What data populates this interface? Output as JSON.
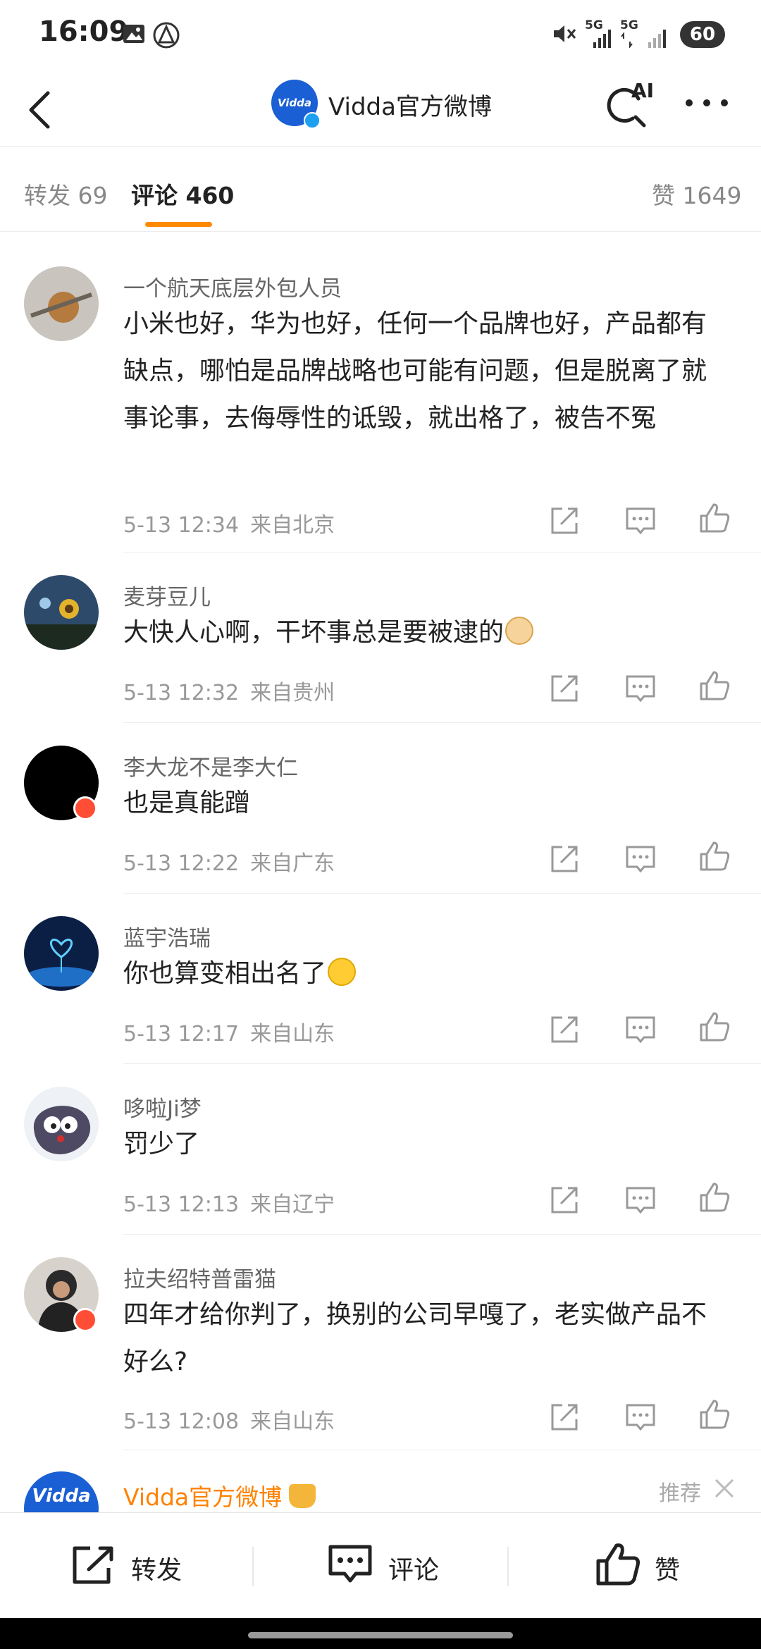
{
  "status_bar": {
    "time": "16:09",
    "network_1": "5G",
    "network_2": "5G",
    "battery": "60"
  },
  "header": {
    "avatar_text": "Vidda",
    "title": "Vidda官方微博",
    "ai_label": "AI"
  },
  "tabs": [
    {
      "label": "转发 69"
    },
    {
      "label": "评论 460"
    },
    {
      "label": "赞 1649"
    }
  ],
  "comments": [
    {
      "user": "一个航天底层外包人员",
      "text": "小米也好，华为也好，任何一个品牌也好，产品都有缺点，哪怕是品牌战略也可能有问题，但是脱离了就事论事，去侮辱性的诋毁，就出格了，被告不冤",
      "time": "5-13 12:34",
      "location": "来自北京"
    },
    {
      "user": "麦芽豆儿",
      "text": "大快人心啊，干坏事总是要被逮的",
      "time": "5-13 12:32",
      "location": "来自贵州"
    },
    {
      "user": "李大龙不是李大仁",
      "text": "也是真能蹭",
      "time": "5-13 12:22",
      "location": "来自广东"
    },
    {
      "user": "蓝宇浩瑞",
      "text": "你也算变相出名了",
      "time": "5-13 12:17",
      "location": "来自山东"
    },
    {
      "user": "哆啦Ji梦",
      "text": "罚少了",
      "time": "5-13 12:13",
      "location": "来自辽宁"
    },
    {
      "user": "拉夫绍特普雷猫",
      "text": "四年才给你判了，换别的公司早嘎了，老实做产品不好么?",
      "time": "5-13 12:08",
      "location": "来自山东"
    }
  ],
  "recommended": {
    "avatar_text": "Vidda",
    "name": "Vidda官方微博",
    "tag": "推荐"
  },
  "bottom_bar": {
    "repost": "转发",
    "comment": "评论",
    "like": "赞"
  },
  "colors": {
    "accent": "#ff8a00",
    "brand_blue": "#1a5fd3",
    "badge_red": "#ff4d36"
  }
}
